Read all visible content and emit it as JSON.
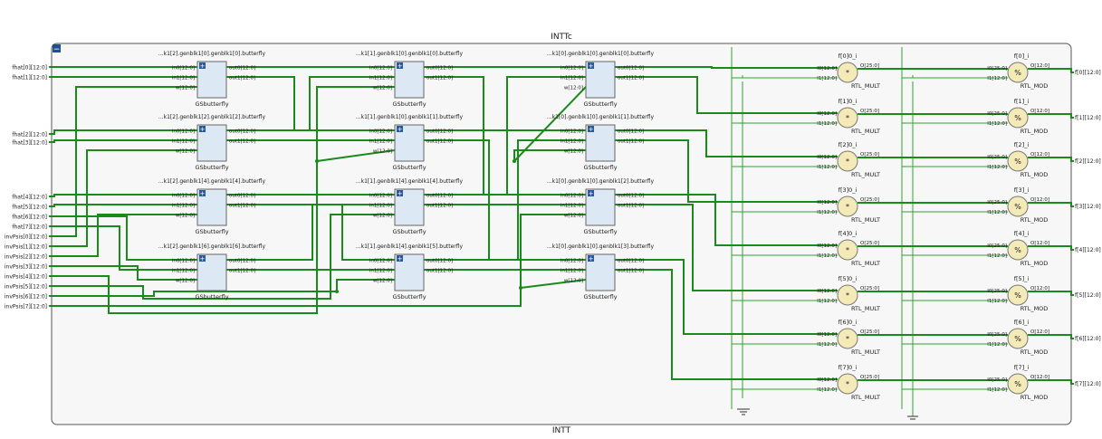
{
  "module_title": "INTTc",
  "module_name": "INTT",
  "collapse_glyph": "−",
  "expand_glyph": "+",
  "colors": {
    "wire": "#1a8a1a",
    "thin_wire": "#2fa32f",
    "block_fill": "#dde8f5",
    "block_stroke": "#666666",
    "op_fill": "#f3eab8",
    "frame": "#555555"
  },
  "inputs": [
    "fhat[0][12:0]",
    "fhat[1][12:0]",
    "fhat[2][12:0]",
    "fhat[3][12:0]",
    "fhat[4][12:0]",
    "fhat[5][12:0]",
    "fhat[6][12:0]",
    "fhat[7][12:0]",
    "invPsis[0][12:0]",
    "invPsis[1][12:0]",
    "invPsis[2][12:0]",
    "invPsis[3][12:0]",
    "invPsis[4][12:0]",
    "invPsis[5][12:0]",
    "invPsis[6][12:0]",
    "invPsis[7][12:0]"
  ],
  "butterfly_cell": "GSbutterfly",
  "butterfly_pins": {
    "in0": "in0[12:0]",
    "in1": "in1[12:0]",
    "w": "w[12:0]",
    "out0": "out0[12:0]",
    "out1": "out1[12:0]"
  },
  "butterflies": [
    {
      "col": 0,
      "row": 0,
      "name": "...k1[2].genblk1[0].genblk1[0].butterfly"
    },
    {
      "col": 0,
      "row": 1,
      "name": "...k1[2].genblk1[2].genblk1[2].butterfly"
    },
    {
      "col": 0,
      "row": 2,
      "name": "...k1[2].genblk1[4].genblk1[4].butterfly"
    },
    {
      "col": 0,
      "row": 3,
      "name": "...k1[2].genblk1[6].genblk1[6].butterfly"
    },
    {
      "col": 1,
      "row": 0,
      "name": "...k1[1].genblk1[0].genblk1[0].butterfly"
    },
    {
      "col": 1,
      "row": 1,
      "name": "...k1[1].genblk1[0].genblk1[1].butterfly"
    },
    {
      "col": 1,
      "row": 2,
      "name": "...k1[1].genblk1[4].genblk1[4].butterfly"
    },
    {
      "col": 1,
      "row": 3,
      "name": "...k1[1].genblk1[4].genblk1[5].butterfly"
    },
    {
      "col": 2,
      "row": 0,
      "name": "...k1[0].genblk1[0].genblk1[0].butterfly"
    },
    {
      "col": 2,
      "row": 1,
      "name": "...k1[0].genblk1[0].genblk1[1].butterfly"
    },
    {
      "col": 2,
      "row": 2,
      "name": "...k1[0].genblk1[0].genblk1[2].butterfly"
    },
    {
      "col": 2,
      "row": 3,
      "name": "...k1[0].genblk1[0].genblk1[3].butterfly"
    }
  ],
  "mult": {
    "cell": "RTL_MULT",
    "symbol": "*",
    "pin_i0": "I0[12:0]",
    "pin_i1": "I1[12:0]",
    "pin_o": "O[25:0]"
  },
  "mod": {
    "cell": "RTL_MOD",
    "symbol": "%",
    "pin_i0": "I0[25:0]",
    "pin_i1": "I1[12:0]",
    "pin_o": "O[12:0]"
  },
  "mult_names": [
    "f[0]0_i",
    "f[1]0_i",
    "f[2]0_i",
    "f[3]0_i",
    "f[4]0_i",
    "f[5]0_i",
    "f[6]0_i",
    "f[7]0_i"
  ],
  "mod_names": [
    "f[0]_i",
    "f[1]_i",
    "f[2]_i",
    "f[3]_i",
    "f[4]_i",
    "f[5]_i",
    "f[6]_i",
    "f[7]_i"
  ],
  "outputs": [
    "f[0][12:0]",
    "f[1][12:0]",
    "f[2][12:0]",
    "f[3][12:0]",
    "f[4][12:0]",
    "f[5][12:0]",
    "f[6][12:0]",
    "f[7][12:0]"
  ]
}
